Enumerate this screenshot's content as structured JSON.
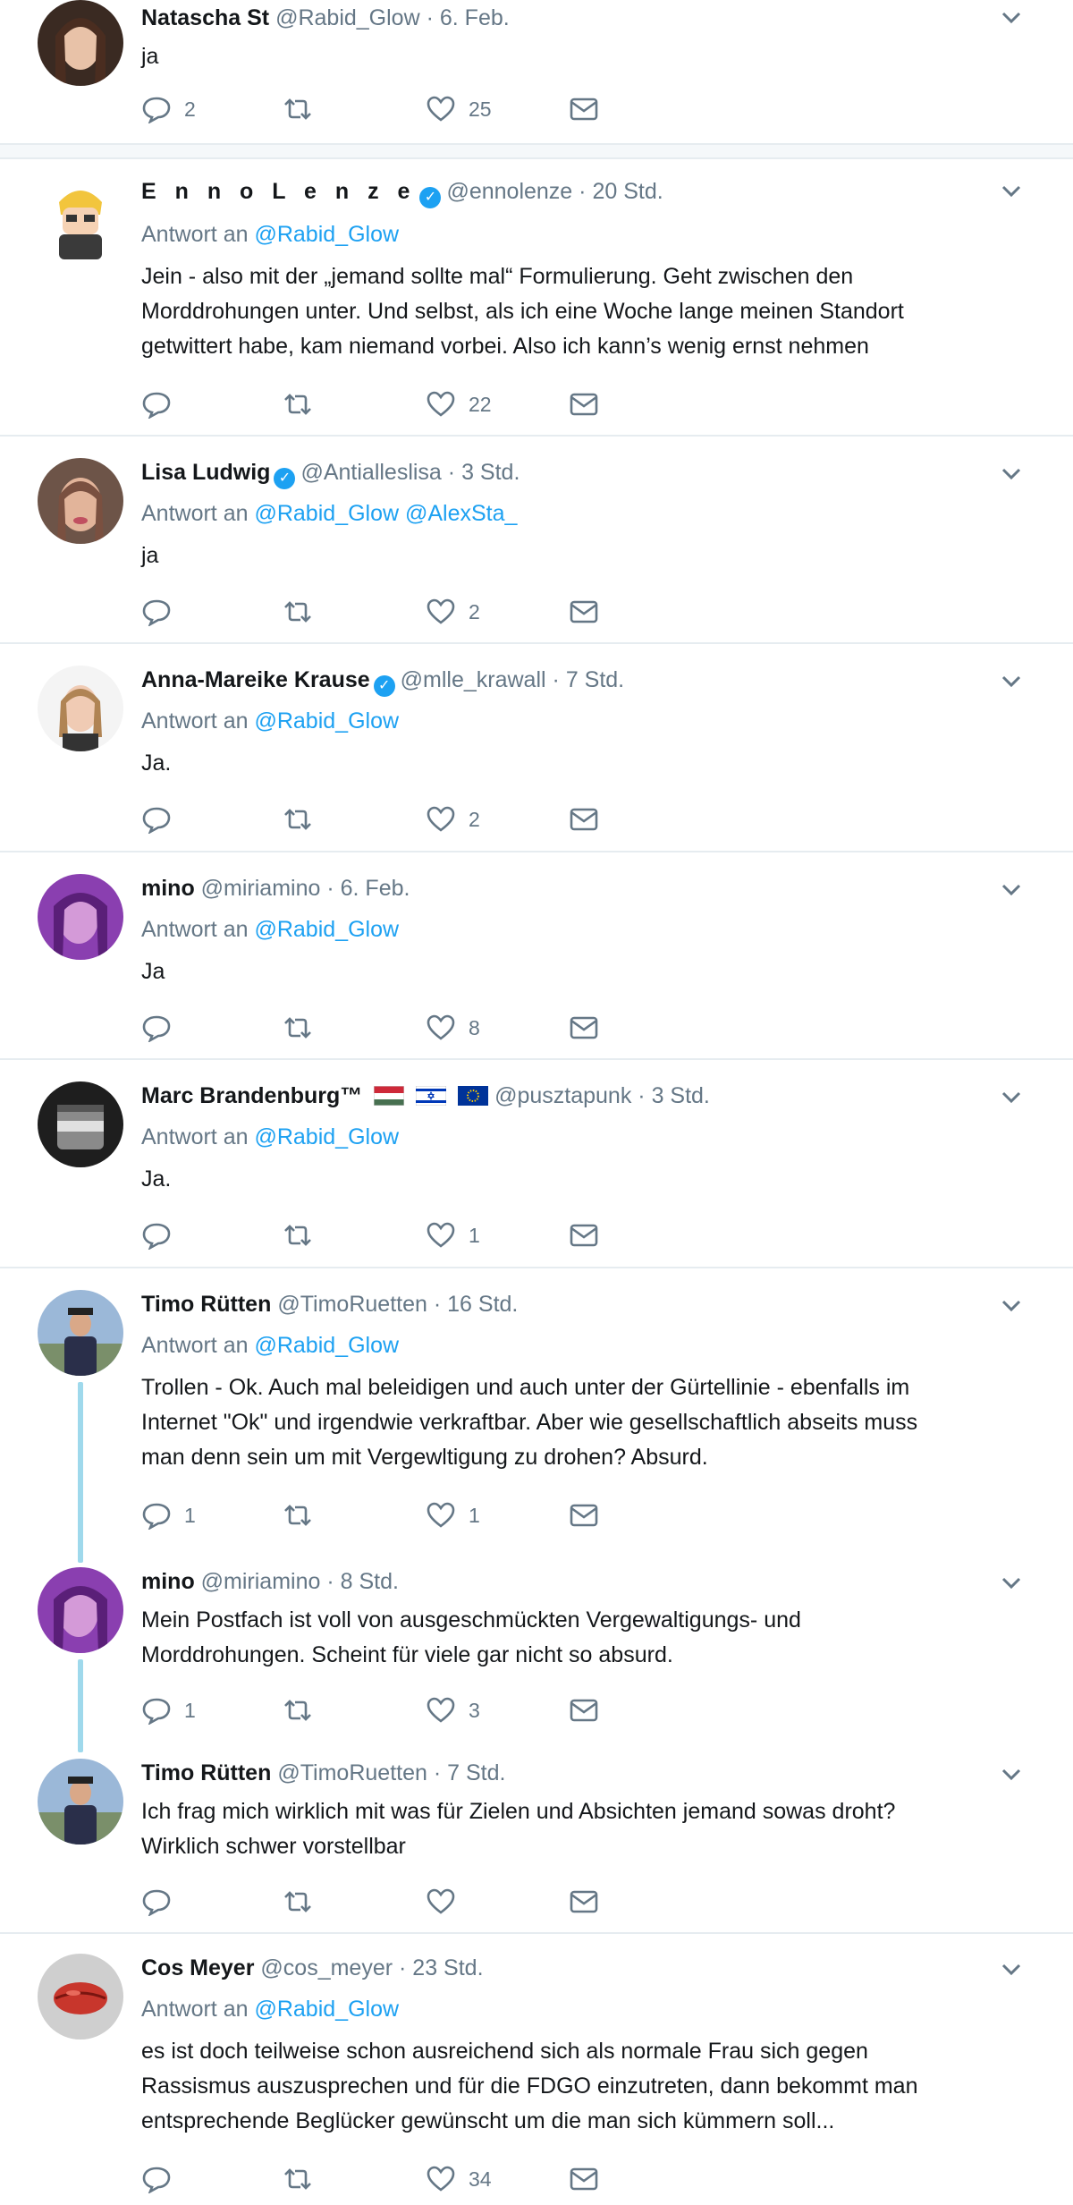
{
  "tweets": [
    {
      "name": "Natascha St",
      "handle": "@Rabid_Glow",
      "time": "6. Feb.",
      "verified": false,
      "reply_to": null,
      "text": [
        "ja"
      ],
      "replies": "2",
      "retweets": "",
      "likes": "25"
    },
    {
      "name": "E n n o  L e n z e",
      "handle": "@ennolenze",
      "time": "20 Std.",
      "verified": true,
      "reply_to": [
        "@Rabid_Glow"
      ],
      "text": [
        "Jein - also mit der „jemand sollte mal“ Formulierung. Geht zwischen den",
        "Morddrohungen unter. Und selbst, als ich eine Woche lange meinen Standort",
        "getwittert habe, kam niemand vorbei. Also ich kann’s wenig ernst nehmen"
      ],
      "replies": "",
      "retweets": "",
      "likes": "22"
    },
    {
      "name": "Lisa Ludwig",
      "handle": "@Antialleslisa",
      "time": "3 Std.",
      "verified": true,
      "reply_to": [
        "@Rabid_Glow",
        "@AlexSta_"
      ],
      "text": [
        "ja"
      ],
      "replies": "",
      "retweets": "",
      "likes": "2"
    },
    {
      "name": "Anna-Mareike Krause",
      "handle": "@mlle_krawall",
      "time": "7 Std.",
      "verified": true,
      "reply_to": [
        "@Rabid_Glow"
      ],
      "text": [
        "Ja."
      ],
      "replies": "",
      "retweets": "",
      "likes": "2"
    },
    {
      "name": "mino",
      "handle": "@miriamino",
      "time": "6. Feb.",
      "verified": false,
      "reply_to": [
        "@Rabid_Glow"
      ],
      "text": [
        "Ja"
      ],
      "replies": "",
      "retweets": "",
      "likes": "8"
    },
    {
      "name": "Marc Brandenburg™",
      "handle": "@pusztapunk",
      "time": "3 Std.",
      "verified": false,
      "flags": [
        "hungary-flag-icon",
        "israel-flag-icon",
        "eu-flag-icon"
      ],
      "reply_to": [
        "@Rabid_Glow"
      ],
      "text": [
        "Ja."
      ],
      "replies": "",
      "retweets": "",
      "likes": "1"
    },
    {
      "name": "Timo Rütten",
      "handle": "@TimoRuetten",
      "time": "16 Std.",
      "verified": false,
      "reply_to": [
        "@Rabid_Glow"
      ],
      "text": [
        "Trollen - Ok. Auch mal beleidigen und auch unter der Gürtellinie - ebenfalls im",
        "Internet \"Ok\" und irgendwie verkraftbar. Aber wie gesellschaftlich abseits muss",
        "man denn sein um mit Vergewltigung zu drohen? Absurd."
      ],
      "replies": "1",
      "retweets": "",
      "likes": "1"
    },
    {
      "name": "mino",
      "handle": "@miriamino",
      "time": "8 Std.",
      "verified": false,
      "reply_to": null,
      "text": [
        "Mein Postfach ist voll von ausgeschmückten Vergewaltigungs- und",
        "Morddrohungen. Scheint für viele gar nicht so absurd."
      ],
      "replies": "1",
      "retweets": "",
      "likes": "3"
    },
    {
      "name": "Timo Rütten",
      "handle": "@TimoRuetten",
      "time": "7 Std.",
      "verified": false,
      "reply_to": null,
      "text": [
        "Ich frag mich wirklich mit was für Zielen und Absichten jemand sowas droht?",
        "Wirklich schwer vorstellbar"
      ],
      "replies": "",
      "retweets": "",
      "likes": ""
    },
    {
      "name": "Cos Meyer",
      "handle": "@cos_meyer",
      "time": "23 Std.",
      "verified": false,
      "reply_to": [
        "@Rabid_Glow"
      ],
      "text": [
        "es ist doch teilweise schon ausreichend sich als normale Frau sich gegen",
        "Rassismus auszusprechen und für die FDGO einzutreten, dann bekommt man",
        "entsprechende Beglücker gewünscht um die man sich kümmern soll..."
      ],
      "replies": "",
      "retweets": "",
      "likes": "34"
    }
  ],
  "labels": {
    "reply_prefix": "Antwort an",
    "dot": "·"
  },
  "colors": {
    "accent": "#1da1f2",
    "muted": "#657786",
    "text": "#14171a",
    "thread": "#9fd9ec"
  }
}
